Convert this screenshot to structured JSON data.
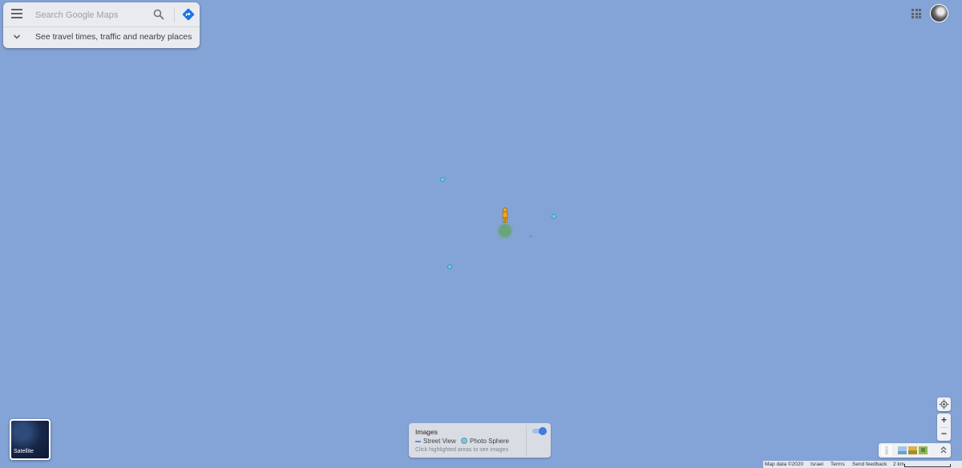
{
  "search": {
    "placeholder": "Search Google Maps",
    "travel_prompt": "See travel times, traffic and nearby places"
  },
  "icons": {
    "menu": "menu-icon",
    "search": "search-icon",
    "directions": "directions-icon",
    "apps": "apps-grid-icon",
    "chevron": "chevron-down-icon",
    "pegman": "pegman-icon",
    "location": "my-location-icon",
    "expand": "expand-icon"
  },
  "layers": {
    "satellite_label": "Satellite"
  },
  "images_panel": {
    "title": "Images",
    "street_view": "Street View",
    "photo_sphere": "Photo Sphere",
    "hint": "Click highlighted areas to see images",
    "toggle_on": true
  },
  "zoom": {
    "in": "+",
    "out": "−"
  },
  "footer": {
    "map_data": "Map data ©2020",
    "region": "Israel",
    "terms": "Terms",
    "feedback": "Send feedback",
    "scale": "2 km"
  },
  "colors": {
    "water": "#84a3d6",
    "accent": "#3d7be0",
    "photo_sphere": "#20a0c8",
    "pegman": "#f0a81c"
  }
}
